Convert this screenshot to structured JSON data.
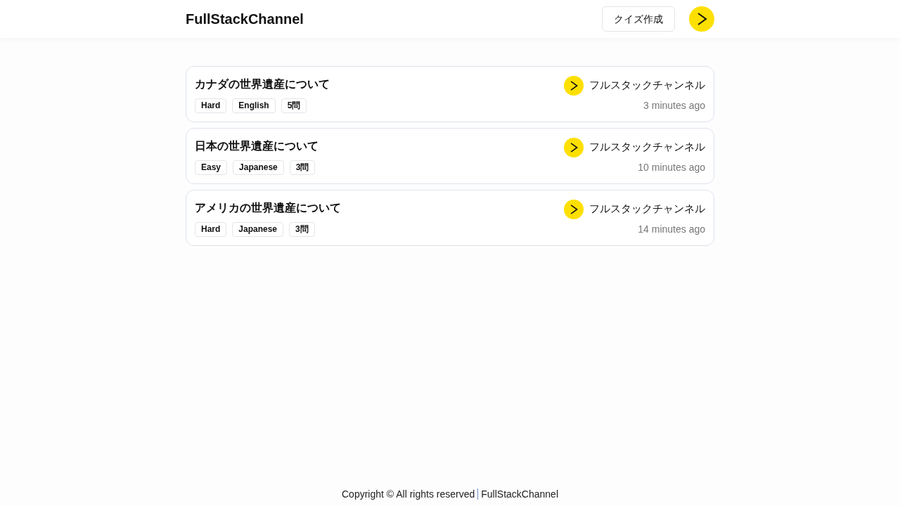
{
  "header": {
    "brand": "FullStackChannel",
    "create_button": "クイズ作成"
  },
  "quizzes": [
    {
      "title": "カナダの世界遺産について",
      "tags": [
        "Hard",
        "English",
        "5問"
      ],
      "author": "フルスタックチャンネル",
      "time": "3 minutes ago"
    },
    {
      "title": "日本の世界遺産について",
      "tags": [
        "Easy",
        "Japanese",
        "3問"
      ],
      "author": "フルスタックチャンネル",
      "time": "10 minutes ago"
    },
    {
      "title": "アメリカの世界遺産について",
      "tags": [
        "Hard",
        "Japanese",
        "3問"
      ],
      "author": "フルスタックチャンネル",
      "time": "14 minutes ago"
    }
  ],
  "footer": {
    "copyright": "Copyright © All rights reserved",
    "brand": "FullStackChannel"
  }
}
